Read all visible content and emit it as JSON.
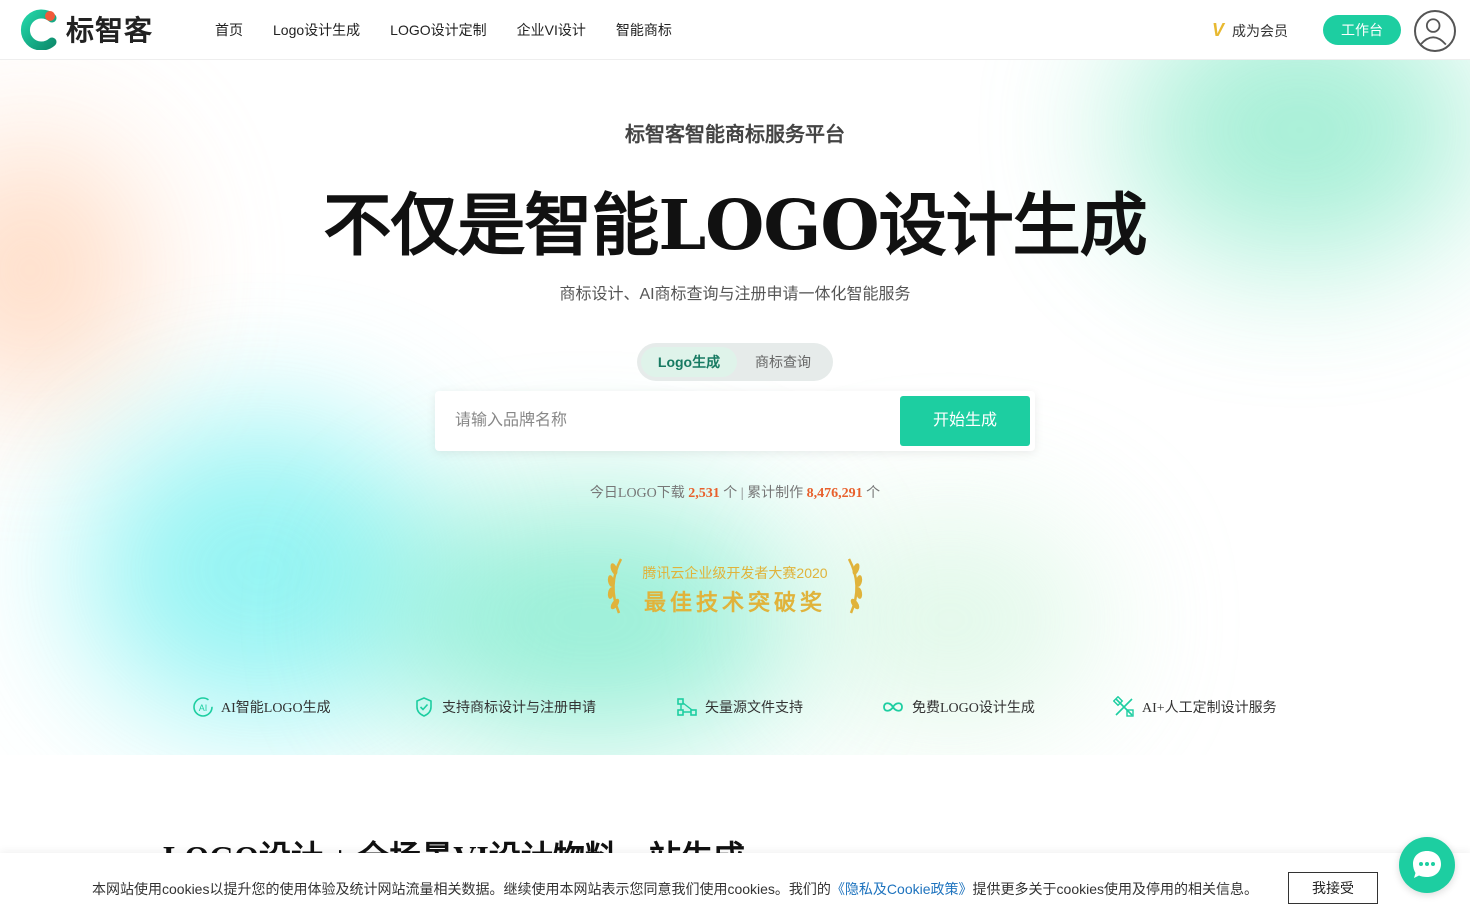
{
  "header": {
    "brand": "标智客",
    "nav": [
      "首页",
      "Logo设计生成",
      "LOGO设计定制",
      "企业VI设计",
      "智能商标"
    ],
    "vip_label": "成为会员",
    "workbench_label": "工作台"
  },
  "hero": {
    "subtitle": "标智客智能商标服务平台",
    "title": "不仅是智能LOGO设计生成",
    "description": "商标设计、AI商标查询与注册申请一体化智能服务",
    "tabs": [
      "Logo生成",
      "商标查询"
    ],
    "search_placeholder": "请输入品牌名称",
    "search_button": "开始生成",
    "stats": {
      "today_prefix": "今日LOGO下载",
      "today_count": "2,531",
      "unit": "个",
      "separator": "| 累计制作",
      "total_count": "8,476,291"
    },
    "award": {
      "line1": "腾讯云企业级开发者大赛2020",
      "line2": "最佳技术突破奖"
    },
    "features": [
      {
        "icon": "ai-icon",
        "label": "AI智能LOGO生成"
      },
      {
        "icon": "shield-check-icon",
        "label": "支持商标设计与注册申请"
      },
      {
        "icon": "vector-nodes-icon",
        "label": "矢量源文件支持"
      },
      {
        "icon": "infinity-icon",
        "label": "免费LOGO设计生成"
      },
      {
        "icon": "design-tools-icon",
        "label": "AI+人工定制设计服务"
      }
    ]
  },
  "section": {
    "title": "LOGO设计 + 全场景VI设计物料一站生成"
  },
  "cookie": {
    "text_before": "本网站使用cookies以提升您的使用体验及统计网站流量相关数据。继续使用本网站表示您同意我们使用cookies。我们的",
    "link": "《隐私及Cookie政策》",
    "text_after": "提供更多关于cookies使用及停用的相关信息。",
    "accept": "我接受"
  },
  "colors": {
    "accent": "#1dcea1",
    "number": "#e8602c",
    "award_gold": "#e0b33b"
  }
}
